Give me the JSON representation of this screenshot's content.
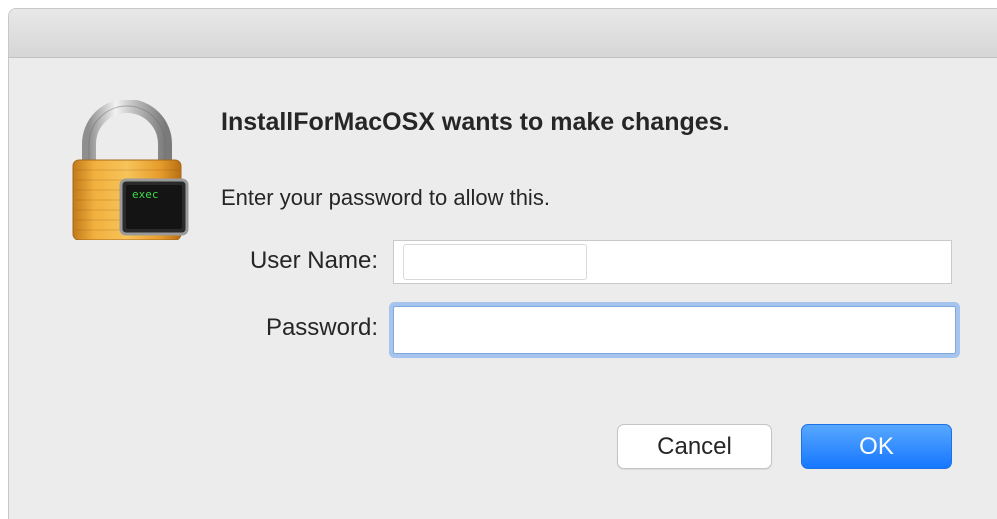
{
  "dialog": {
    "heading": "InstallForMacOSX wants to make changes.",
    "subtext": "Enter your password to allow this.",
    "icon": {
      "name": "padlock-icon",
      "badge_text": "exec",
      "lock_color": "#e8a23a",
      "badge_text_color": "#3fd84a"
    },
    "fields": {
      "username_label": "User Name:",
      "username_value": "",
      "password_label": "Password:",
      "password_value": ""
    },
    "buttons": {
      "cancel_label": "Cancel",
      "ok_label": "OK"
    },
    "colors": {
      "ok_button": "#1a7cff",
      "focus_ring": "#a6c5ee"
    }
  }
}
